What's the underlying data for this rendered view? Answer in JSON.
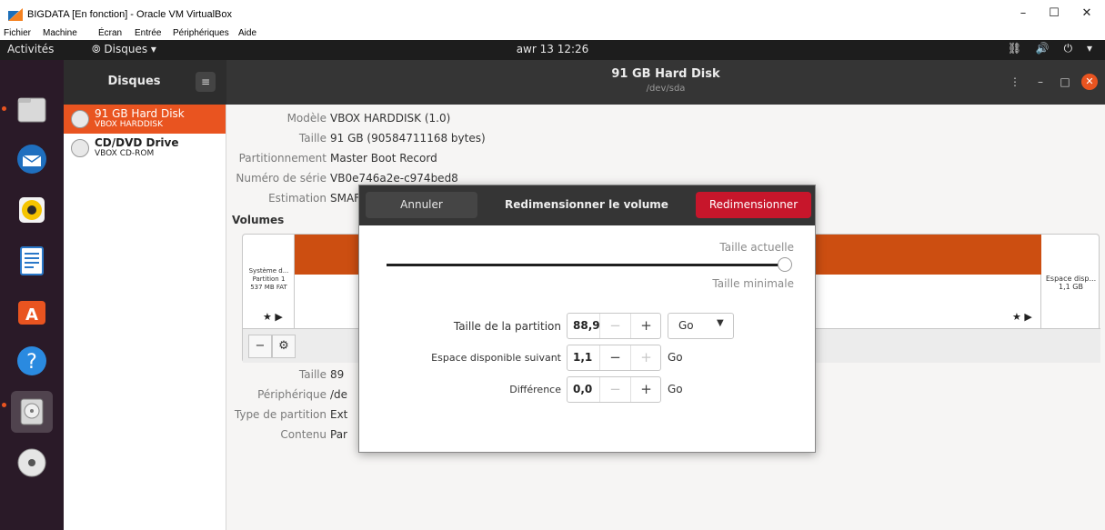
{
  "host_window": {
    "title": "BIGDATA [En fonction] - Oracle VM VirtualBox",
    "controls": {
      "minimize": "–",
      "maximize": "☐",
      "close": "✕"
    },
    "menu": [
      "Fichier",
      "Machine",
      "Écran",
      "Entrée",
      "Périphériques",
      "Aide"
    ]
  },
  "topbar": {
    "activities": "Activités",
    "app_menu": "⦾ Disques ▾",
    "clock": "awr 13  12:26",
    "system_icons": "⛓ 🔊 ⏻ ▾"
  },
  "dock": {
    "items": [
      "files-icon",
      "thunderbird-icon",
      "rhythmbox-icon",
      "libreoffice-writer-icon",
      "software-center-icon",
      "help-icon",
      "disks-icon",
      "optical-disc-icon"
    ]
  },
  "disks_app": {
    "sidebar_title": "Disques",
    "sidebar_menu_button": "≡",
    "header_title": "91 GB Hard Disk",
    "header_subtitle": "/dev/sda",
    "drives": [
      {
        "name": "91 GB Hard Disk",
        "sub": "VBOX HARDDISK"
      },
      {
        "name": "CD/DVD Drive",
        "sub": "VBOX CD-ROM"
      }
    ],
    "details": [
      {
        "label": "Modèle",
        "value": "VBOX HARDDISK (1.0)"
      },
      {
        "label": "Taille",
        "value": "91 GB (90584711168 bytes)"
      },
      {
        "label": "Partitionnement",
        "value": "Master Boot Record"
      },
      {
        "label": "Numéro de série",
        "value": "VB0e746a2e-c974bed8"
      },
      {
        "label": "Estimation",
        "value": "SMAF"
      }
    ],
    "volumes_title": "Volumes",
    "partition1": {
      "line1": "Système d...",
      "line2": "Partition 1",
      "line3": "537 MB FAT"
    },
    "partition3": {
      "line1": "Espace disp...",
      "line2": "1,1 GB"
    },
    "star_marker": "★ ▶",
    "volume_toolbar": {
      "remove": "−",
      "settings": "⚙"
    },
    "vol_details": [
      {
        "label": "Taille",
        "value": "89"
      },
      {
        "label": "Périphérique",
        "value": "/de"
      },
      {
        "label": "Type de partition",
        "value": "Ext"
      },
      {
        "label": "Contenu",
        "value": "Par"
      }
    ]
  },
  "dialog": {
    "cancel": "Annuler",
    "title": "Redimensionner le volume",
    "ok": "Redimensionner",
    "hint_current": "Taille actuelle",
    "hint_min": "Taille minimale",
    "slider_fraction": 1.0,
    "fields": [
      {
        "label": "Taille de la partition",
        "value": "88,9",
        "minus": "−",
        "plus": "+",
        "unit": "Go"
      },
      {
        "label": "Espace disponible suivant",
        "value": "1,1",
        "minus": "−",
        "plus": "+",
        "unit": "Go"
      },
      {
        "label": "Différence",
        "value": "0,0",
        "minus": "−",
        "plus": "+",
        "unit": "Go"
      }
    ],
    "unit_dropdown_arrow": "▼"
  },
  "colors": {
    "accent": "#e95420",
    "destructive": "#c7162b",
    "partition_fill": "#cc4e11",
    "header_dark": "#353535"
  }
}
